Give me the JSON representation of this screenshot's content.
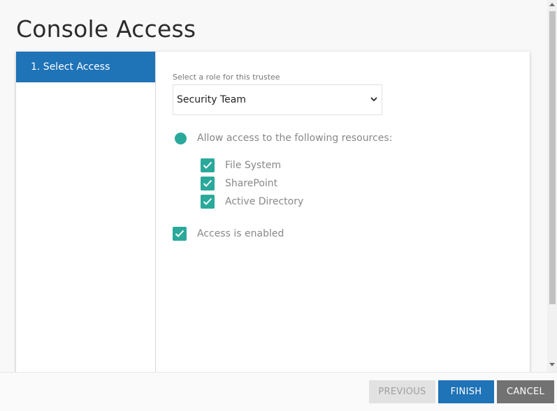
{
  "page": {
    "title": "Console Access"
  },
  "wizard": {
    "steps": [
      {
        "label": "1. Select Access",
        "active": true
      }
    ]
  },
  "role": {
    "label": "Select a role for this trustee",
    "selected": "Security Team"
  },
  "access": {
    "radio_label": "Allow access to the following resources:",
    "resources": [
      {
        "label": "File System",
        "checked": true
      },
      {
        "label": "SharePoint",
        "checked": true
      },
      {
        "label": "Active Directory",
        "checked": true
      }
    ],
    "enabled_label": "Access is enabled",
    "enabled_checked": true
  },
  "footer": {
    "previous_label": "PREVIOUS",
    "finish_label": "FINISH",
    "cancel_label": "CANCEL"
  },
  "colors": {
    "primary": "#1f73b7",
    "accent": "#2aa99b",
    "cancel": "#727272",
    "disabled": "#e2e2e2"
  },
  "icons": [
    "chevron-down-icon",
    "check-icon"
  ]
}
